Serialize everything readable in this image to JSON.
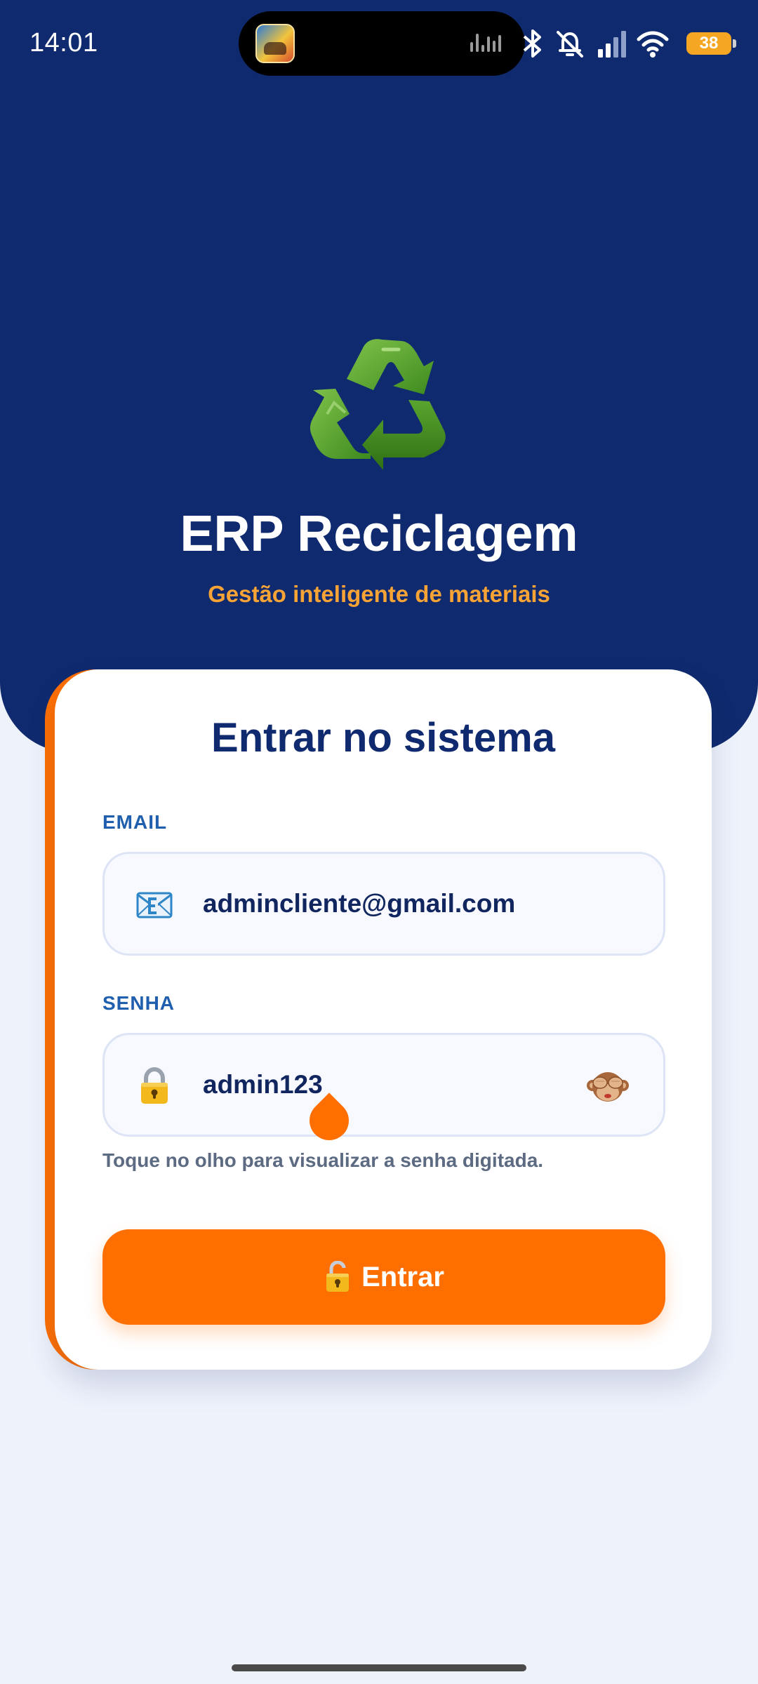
{
  "status_bar": {
    "time": "14:01",
    "battery_level": "38",
    "icons": [
      "bluetooth-icon",
      "silent-icon",
      "signal-icon",
      "wifi-icon",
      "battery-icon"
    ]
  },
  "brand": {
    "title": "ERP Reciclagem",
    "subtitle": "Gestão inteligente de materiais",
    "logo_icon": "recycle-icon",
    "colors": {
      "primary": "#0f2a6e",
      "accent": "#ff6f00",
      "subtitle": "#f7a335"
    }
  },
  "login": {
    "heading": "Entrar no sistema",
    "email": {
      "label": "EMAIL",
      "icon": "envelope-icon",
      "value": "admincliente@gmail.com"
    },
    "password": {
      "label": "SENHA",
      "icon": "lock-icon",
      "value": "admin123",
      "toggle_icon": "see-no-evil-monkey-icon",
      "hint": "Toque no olho para visualizar a senha digitada."
    },
    "submit": {
      "icon": "unlock-icon",
      "label": "Entrar"
    }
  }
}
